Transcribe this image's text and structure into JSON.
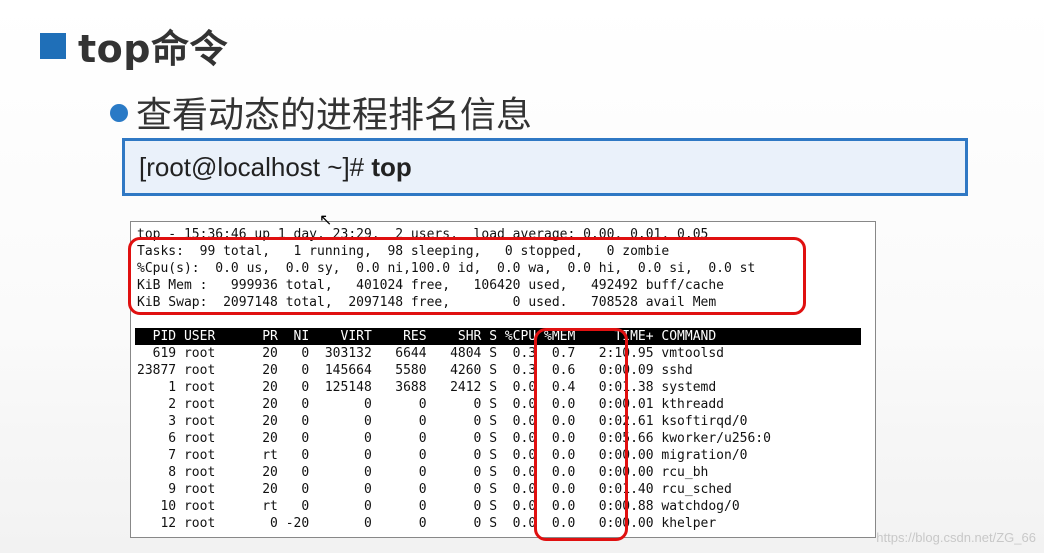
{
  "slide": {
    "title": "top命令",
    "bullet": "查看动态的进程排名信息",
    "command_prefix": "[root@localhost ~]# ",
    "command": "top"
  },
  "terminal": {
    "summary_lines": [
      "top - 15:36:46 up 1 day, 23:29,  2 users,  load average: 0.00, 0.01, 0.05",
      "Tasks:  99 total,   1 running,  98 sleeping,   0 stopped,   0 zombie",
      "%Cpu(s):  0.0 us,  0.0 sy,  0.0 ni,100.0 id,  0.0 wa,  0.0 hi,  0.0 si,  0.0 st",
      "KiB Mem :   999936 total,   401024 free,   106420 used,   492492 buff/cache",
      "KiB Swap:  2097148 total,  2097148 free,        0 used.   708528 avail Mem"
    ],
    "header": "  PID USER      PR  NI    VIRT    RES    SHR S %CPU %MEM     TIME+ COMMAND",
    "rows": [
      "  619 root      20   0  303132   6644   4804 S  0.3  0.7   2:10.95 vmtoolsd",
      "23877 root      20   0  145664   5580   4260 S  0.3  0.6   0:00.09 sshd",
      "    1 root      20   0  125148   3688   2412 S  0.0  0.4   0:01.38 systemd",
      "    2 root      20   0       0      0      0 S  0.0  0.0   0:00.01 kthreadd",
      "    3 root      20   0       0      0      0 S  0.0  0.0   0:02.61 ksoftirqd/0",
      "    6 root      20   0       0      0      0 S  0.0  0.0   0:05.66 kworker/u256:0",
      "    7 root      rt   0       0      0      0 S  0.0  0.0   0:00.00 migration/0",
      "    8 root      20   0       0      0      0 S  0.0  0.0   0:00.00 rcu_bh",
      "    9 root      20   0       0      0      0 S  0.0  0.0   0:01.40 rcu_sched",
      "   10 root      rt   0       0      0      0 S  0.0  0.0   0:00.88 watchdog/0",
      "   12 root       0 -20       0      0      0 S  0.0  0.0   0:00.00 khelper"
    ]
  },
  "watermark": "https://blog.csdn.net/ZG_66",
  "colors": {
    "accent": "#1f6fb8",
    "highlight": "#e01010"
  }
}
